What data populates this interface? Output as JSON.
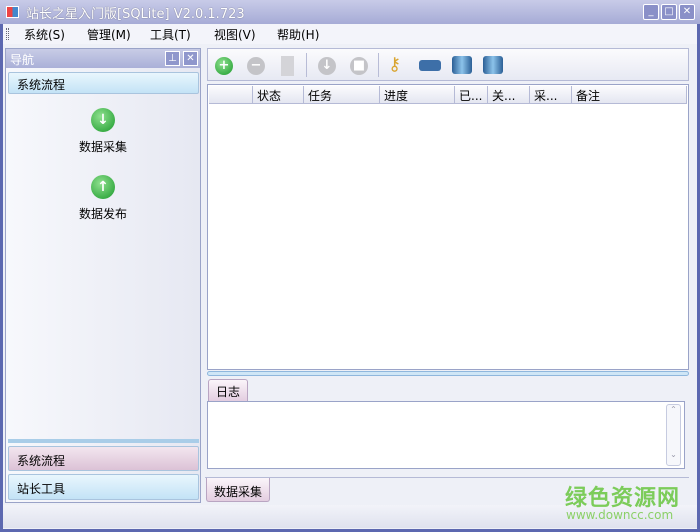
{
  "window": {
    "title": "站长之星入门版[SQLite] V2.0.1.723",
    "min": "_",
    "max": "□",
    "close": "✕"
  },
  "menu": [
    "系统(S)",
    "管理(M)",
    "工具(T)",
    "视图(V)",
    "帮助(H)"
  ],
  "nav": {
    "title": "导航",
    "pin": "⊥",
    "close": "✕",
    "group_header": "系统流程",
    "items": [
      {
        "label": "数据采集",
        "icon": "download-arrow-icon"
      },
      {
        "label": "数据发布",
        "icon": "upload-arrow-icon"
      }
    ],
    "bottom_groups": [
      "系统流程",
      "站长工具"
    ]
  },
  "toolbar": [
    "add",
    "remove",
    "edit",
    "down",
    "stop",
    "key",
    "truck",
    "database",
    "database-settings"
  ],
  "grid": {
    "columns": [
      "",
      "状态",
      "任务",
      "进度",
      "已...",
      "关...",
      "采...",
      "备注"
    ]
  },
  "log": {
    "tab": "日志",
    "scroll_up": "⌃",
    "scroll_down": "⌄"
  },
  "bottom_tab": "数据采集",
  "watermark": {
    "title": "绿色资源网",
    "url": "www.downcc.com"
  }
}
